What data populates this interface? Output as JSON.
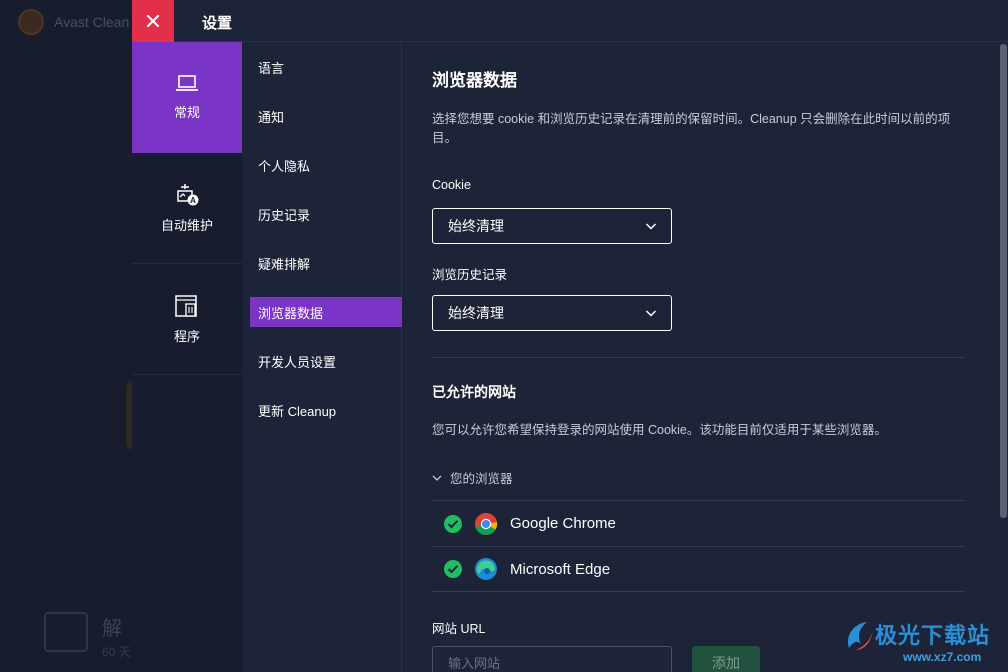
{
  "background_app": {
    "title": "Avast Clean",
    "bottom_title": "解",
    "bottom_sub": "60 天"
  },
  "topbar": {
    "title": "设置"
  },
  "categories": [
    {
      "label": "常规",
      "icon": "laptop-icon",
      "active": true
    },
    {
      "label": "自动维护",
      "icon": "auto-maintenance-icon",
      "active": false
    },
    {
      "label": "程序",
      "icon": "program-trash-icon",
      "active": false
    }
  ],
  "submenu": [
    {
      "label": "语言"
    },
    {
      "label": "通知"
    },
    {
      "label": "个人隐私"
    },
    {
      "label": "历史记录"
    },
    {
      "label": "疑难排解"
    },
    {
      "label": "浏览器数据",
      "active": true
    },
    {
      "label": "开发人员设置"
    },
    {
      "label": "更新 Cleanup"
    }
  ],
  "content": {
    "title": "浏览器数据",
    "description": "选择您想要 cookie 和浏览历史记录在清理前的保留时间。Cleanup 只会删除在此时间以前的项目。",
    "cookie_label": "Cookie",
    "cookie_value": "始终清理",
    "history_label": "浏览历史记录",
    "history_value": "始终清理",
    "allowed_title": "已允许的网站",
    "allowed_description": "您可以允许您希望保持登录的网站使用 Cookie。该功能目前仅适用于某些浏览器。",
    "your_browsers": "您的浏览器",
    "browsers": [
      {
        "name": "Google Chrome",
        "icon": "chrome-icon"
      },
      {
        "name": "Microsoft Edge",
        "icon": "edge-icon"
      }
    ],
    "url_label": "网站 URL",
    "url_placeholder": "输入网站",
    "add_button": "添加"
  },
  "watermark": {
    "text": "极光下载站",
    "url": "www.xz7.com"
  },
  "colors": {
    "accent_purple": "#7a35c7",
    "close_red": "#e2304a",
    "check_green": "#1fbe60",
    "panel_bg": "#1e2438"
  }
}
